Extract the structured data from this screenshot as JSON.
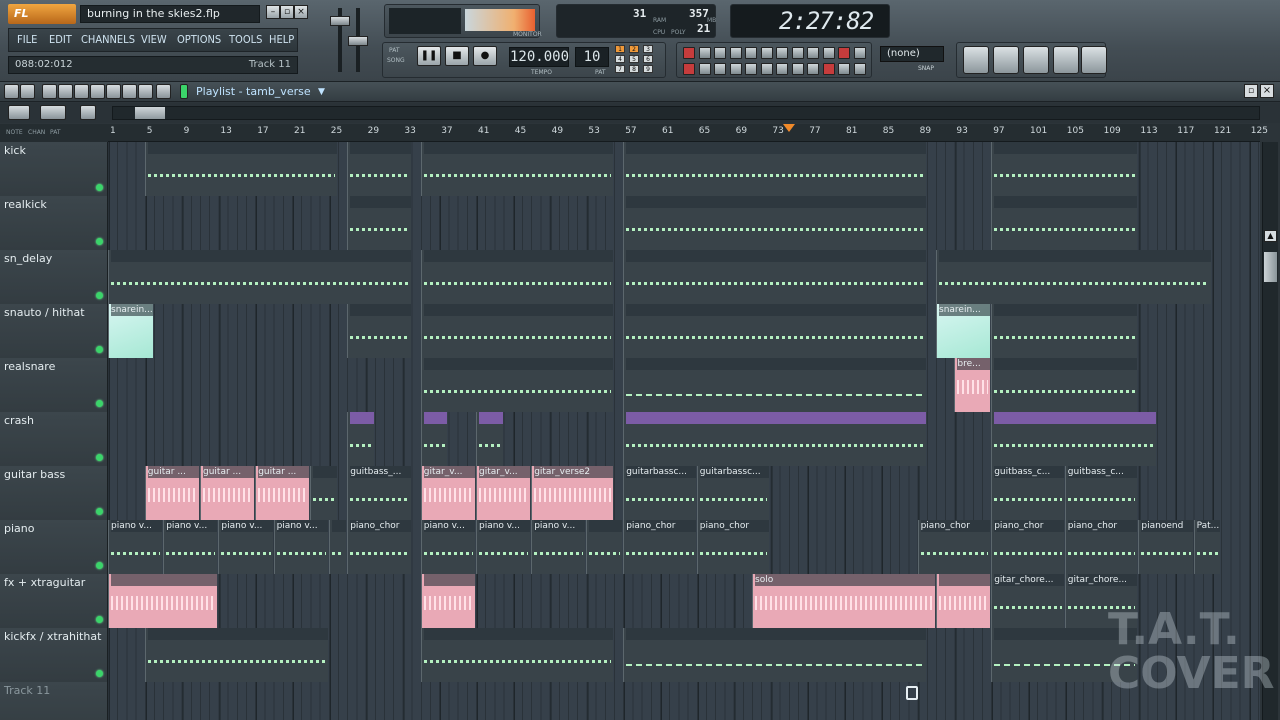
{
  "app": {
    "logo": "FL STUDIO",
    "project_name": "burning in the skies2.flp",
    "window_buttons": {
      "minimize": "–",
      "restore": "▫",
      "close": "×"
    }
  },
  "menu": [
    "FILE",
    "EDIT",
    "CHANNELS",
    "VIEW",
    "OPTIONS",
    "TOOLS",
    "HELP"
  ],
  "hint_bar": {
    "position": "088:02:012",
    "track": "Track 11"
  },
  "monitor": {
    "label": "MONITOR"
  },
  "cpu_panel": {
    "value1": "31",
    "value2": "357",
    "value3": "21",
    "ram_label": "RAM",
    "cpu_label": "CPU",
    "poly_label": "POLY",
    "mb_label": "MB"
  },
  "time_display": "2:27:82",
  "transport": {
    "pat_label": "PAT",
    "song_label": "SONG",
    "tempo": "120.000",
    "tempo_label": "TEMPO",
    "pattern": "10",
    "pattern_label": "PAT",
    "snap_grid": [
      "1",
      "2",
      "3",
      "4",
      "5",
      "6",
      "7",
      "8",
      "9"
    ]
  },
  "snap": {
    "value": "(none)",
    "label": "SNAP"
  },
  "playlist": {
    "title": "Playlist - tamb_verse",
    "col_headers": [
      "NOTE",
      "CHAN",
      "PAT"
    ],
    "ruler_labels": [
      "1",
      "5",
      "9",
      "13",
      "17",
      "21",
      "25",
      "29",
      "33",
      "37",
      "41",
      "45",
      "49",
      "53",
      "57",
      "61",
      "65",
      "69",
      "73",
      "77",
      "81",
      "85",
      "89",
      "93",
      "97",
      "101",
      "105",
      "109",
      "113",
      "117",
      "121",
      "125"
    ],
    "tracks": [
      {
        "name": "kick",
        "clips": [
          {
            "start": 5,
            "end": 26,
            "label": "",
            "style": "normal"
          },
          {
            "start": 27,
            "end": 34,
            "label": "",
            "style": "normal"
          },
          {
            "start": 35,
            "end": 56,
            "label": "",
            "style": "normal"
          },
          {
            "start": 57,
            "end": 90,
            "label": "",
            "style": "normal"
          },
          {
            "start": 97,
            "end": 113,
            "label": "",
            "style": "normal"
          }
        ]
      },
      {
        "name": "realkick",
        "clips": [
          {
            "start": 27,
            "end": 34,
            "label": "",
            "style": "normal"
          },
          {
            "start": 57,
            "end": 90,
            "label": "",
            "style": "normal"
          },
          {
            "start": 97,
            "end": 113,
            "label": "",
            "style": "normal"
          }
        ]
      },
      {
        "name": "sn_delay",
        "clips": [
          {
            "start": 1,
            "end": 34,
            "label": "",
            "style": "normal"
          },
          {
            "start": 35,
            "end": 56,
            "label": "",
            "style": "normal"
          },
          {
            "start": 57,
            "end": 90,
            "label": "",
            "style": "normal"
          },
          {
            "start": 91,
            "end": 121,
            "label": "",
            "style": "normal"
          }
        ]
      },
      {
        "name": "snauto / hithat",
        "clips": [
          {
            "start": 1,
            "end": 6,
            "label": "snarein...",
            "style": "cyan"
          },
          {
            "start": 27,
            "end": 34,
            "label": "",
            "style": "normal"
          },
          {
            "start": 35,
            "end": 56,
            "label": "",
            "style": "normal"
          },
          {
            "start": 57,
            "end": 90,
            "label": "",
            "style": "normal"
          },
          {
            "start": 91,
            "end": 97,
            "label": "snarein...",
            "style": "cyan"
          },
          {
            "start": 97,
            "end": 113,
            "label": "",
            "style": "normal"
          }
        ]
      },
      {
        "name": "realsnare",
        "clips": [
          {
            "start": 35,
            "end": 56,
            "label": "",
            "style": "normal"
          },
          {
            "start": 57,
            "end": 90,
            "label": "",
            "style": "note-bars"
          },
          {
            "start": 93,
            "end": 97,
            "label": "bre...",
            "style": "pink"
          },
          {
            "start": 97,
            "end": 113,
            "label": "",
            "style": "normal"
          }
        ]
      },
      {
        "name": "crash",
        "clips": [
          {
            "start": 27,
            "end": 30,
            "label": "",
            "style": "purple"
          },
          {
            "start": 35,
            "end": 38,
            "label": "",
            "style": "purple"
          },
          {
            "start": 41,
            "end": 44,
            "label": "",
            "style": "purple"
          },
          {
            "start": 57,
            "end": 90,
            "label": "",
            "style": "purple"
          },
          {
            "start": 97,
            "end": 115,
            "label": "",
            "style": "purple"
          }
        ]
      },
      {
        "name": "guitar bass",
        "clips": [
          {
            "start": 5,
            "end": 11,
            "label": "guitar ...",
            "style": "pink"
          },
          {
            "start": 11,
            "end": 17,
            "label": "guitar ...",
            "style": "pink"
          },
          {
            "start": 17,
            "end": 23,
            "label": "guitar ...",
            "style": "pink"
          },
          {
            "start": 23,
            "end": 26,
            "label": "",
            "style": "normal"
          },
          {
            "start": 27,
            "end": 34,
            "label": "guitbass_...",
            "style": "normal"
          },
          {
            "start": 35,
            "end": 41,
            "label": "gitar_v...",
            "style": "pink"
          },
          {
            "start": 41,
            "end": 47,
            "label": "gitar_v...",
            "style": "pink"
          },
          {
            "start": 47,
            "end": 56,
            "label": "gitar_verse2",
            "style": "pink"
          },
          {
            "start": 57,
            "end": 65,
            "label": "guitarbassc...",
            "style": "normal"
          },
          {
            "start": 65,
            "end": 73,
            "label": "guitarbassc...",
            "style": "normal"
          },
          {
            "start": 97,
            "end": 105,
            "label": "guitbass_c...",
            "style": "normal"
          },
          {
            "start": 105,
            "end": 113,
            "label": "guitbass_c...",
            "style": "normal"
          }
        ]
      },
      {
        "name": "piano",
        "clips": [
          {
            "start": 1,
            "end": 7,
            "label": "piano v...",
            "style": "normal"
          },
          {
            "start": 7,
            "end": 13,
            "label": "piano v...",
            "style": "normal"
          },
          {
            "start": 13,
            "end": 19,
            "label": "piano v...",
            "style": "normal"
          },
          {
            "start": 19,
            "end": 25,
            "label": "piano v...",
            "style": "normal"
          },
          {
            "start": 25,
            "end": 27,
            "label": "",
            "style": "normal"
          },
          {
            "start": 27,
            "end": 34,
            "label": "piano_chor",
            "style": "normal"
          },
          {
            "start": 35,
            "end": 41,
            "label": "piano v...",
            "style": "normal"
          },
          {
            "start": 41,
            "end": 47,
            "label": "piano v...",
            "style": "normal"
          },
          {
            "start": 47,
            "end": 53,
            "label": "piano v...",
            "style": "normal"
          },
          {
            "start": 53,
            "end": 57,
            "label": "",
            "style": "normal"
          },
          {
            "start": 57,
            "end": 65,
            "label": "piano_chor",
            "style": "normal"
          },
          {
            "start": 65,
            "end": 73,
            "label": "piano_chor",
            "style": "normal"
          },
          {
            "start": 89,
            "end": 97,
            "label": "piano_chor",
            "style": "normal"
          },
          {
            "start": 97,
            "end": 105,
            "label": "piano_chor",
            "style": "normal"
          },
          {
            "start": 105,
            "end": 113,
            "label": "piano_chor",
            "style": "normal"
          },
          {
            "start": 113,
            "end": 119,
            "label": "pianoend",
            "style": "normal"
          },
          {
            "start": 119,
            "end": 122,
            "label": "Pat...",
            "style": "normal"
          }
        ]
      },
      {
        "name": "fx + xtraguitar",
        "clips": [
          {
            "start": 1,
            "end": 13,
            "label": "",
            "style": "pink"
          },
          {
            "start": 35,
            "end": 41,
            "label": "",
            "style": "pink"
          },
          {
            "start": 71,
            "end": 91,
            "label": "solo",
            "style": "pink"
          },
          {
            "start": 91,
            "end": 97,
            "label": "",
            "style": "pink"
          },
          {
            "start": 97,
            "end": 105,
            "label": "gitar_chore...",
            "style": "normal"
          },
          {
            "start": 105,
            "end": 113,
            "label": "gitar_chore...",
            "style": "normal"
          }
        ]
      },
      {
        "name": "kickfx / xtrahithat",
        "clips": [
          {
            "start": 5,
            "end": 25,
            "label": "",
            "style": "normal"
          },
          {
            "start": 35,
            "end": 56,
            "label": "",
            "style": "normal"
          },
          {
            "start": 57,
            "end": 90,
            "label": "",
            "style": "note-bars"
          },
          {
            "start": 97,
            "end": 113,
            "label": "",
            "style": "note-bars"
          }
        ]
      },
      {
        "name": "Track 11",
        "clips": []
      }
    ]
  },
  "watermark": "T.A.T. COVER"
}
